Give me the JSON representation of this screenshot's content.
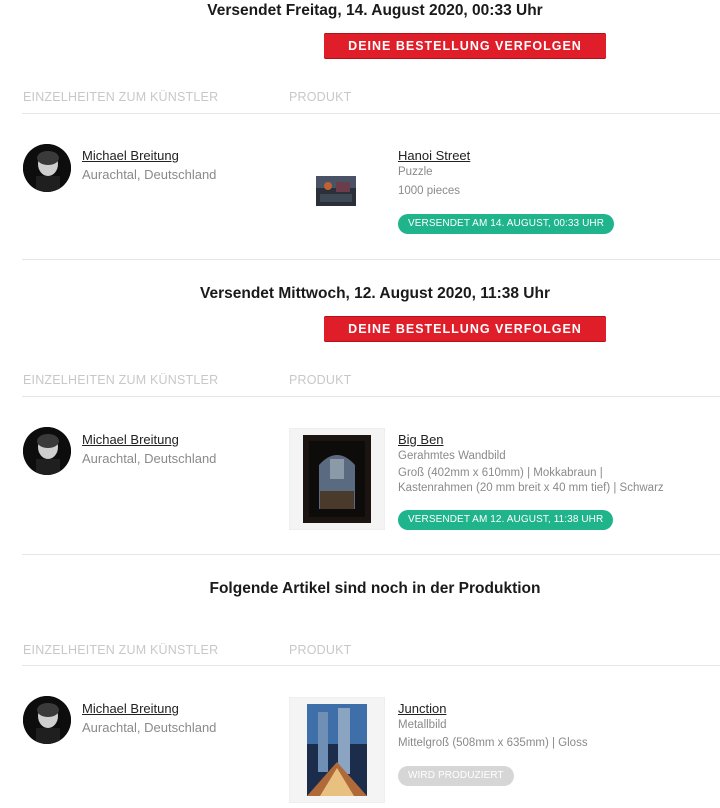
{
  "shipments": [
    {
      "heading": "Versendet Freitag, 14. August 2020, 00:33 Uhr",
      "track_label": "DEINE BESTELLUNG VERFOLGEN",
      "col_artist": "EINZELHEITEN ZUM KÜNSTLER",
      "col_product": "PRODUKT",
      "artist": {
        "name": "Michael Breitung",
        "location": "Aurachtal, Deutschland"
      },
      "product": {
        "title": "Hanoi Street",
        "type": "Puzzle",
        "spec1": "1000 pieces",
        "status": "VERSENDET AM 14. AUGUST, 00:33 UHR"
      }
    },
    {
      "heading": "Versendet Mittwoch, 12. August 2020, 11:38 Uhr",
      "track_label": "DEINE BESTELLUNG VERFOLGEN",
      "col_artist": "EINZELHEITEN ZUM KÜNSTLER",
      "col_product": "PRODUKT",
      "artist": {
        "name": "Michael Breitung",
        "location": "Aurachtal, Deutschland"
      },
      "product": {
        "title": "Big Ben",
        "type": "Gerahmtes Wandbild",
        "spec1": "Groß (402mm x 610mm)   |   Mokkabraun   |",
        "spec2": "Kastenrahmen (20 mm breit x 40 mm tief)   |   Schwarz",
        "status": "VERSENDET AM 12. AUGUST, 11:38 UHR"
      }
    },
    {
      "heading": "Folgende Artikel sind noch in der Produktion",
      "col_artist": "EINZELHEITEN ZUM KÜNSTLER",
      "col_product": "PRODUKT",
      "artist": {
        "name": "Michael Breitung",
        "location": "Aurachtal, Deutschland"
      },
      "product": {
        "title": "Junction",
        "type": "Metallbild",
        "spec1": "Mittelgroß (508mm x 635mm)   |   Gloss",
        "status": "WIRD PRODUZIERT"
      }
    }
  ],
  "colors": {
    "button_red": "#e01e2a",
    "status_green": "#20b48d",
    "status_grey": "#d6d6d6"
  },
  "icons": [
    "artist-avatar",
    "product-thumbnail"
  ]
}
